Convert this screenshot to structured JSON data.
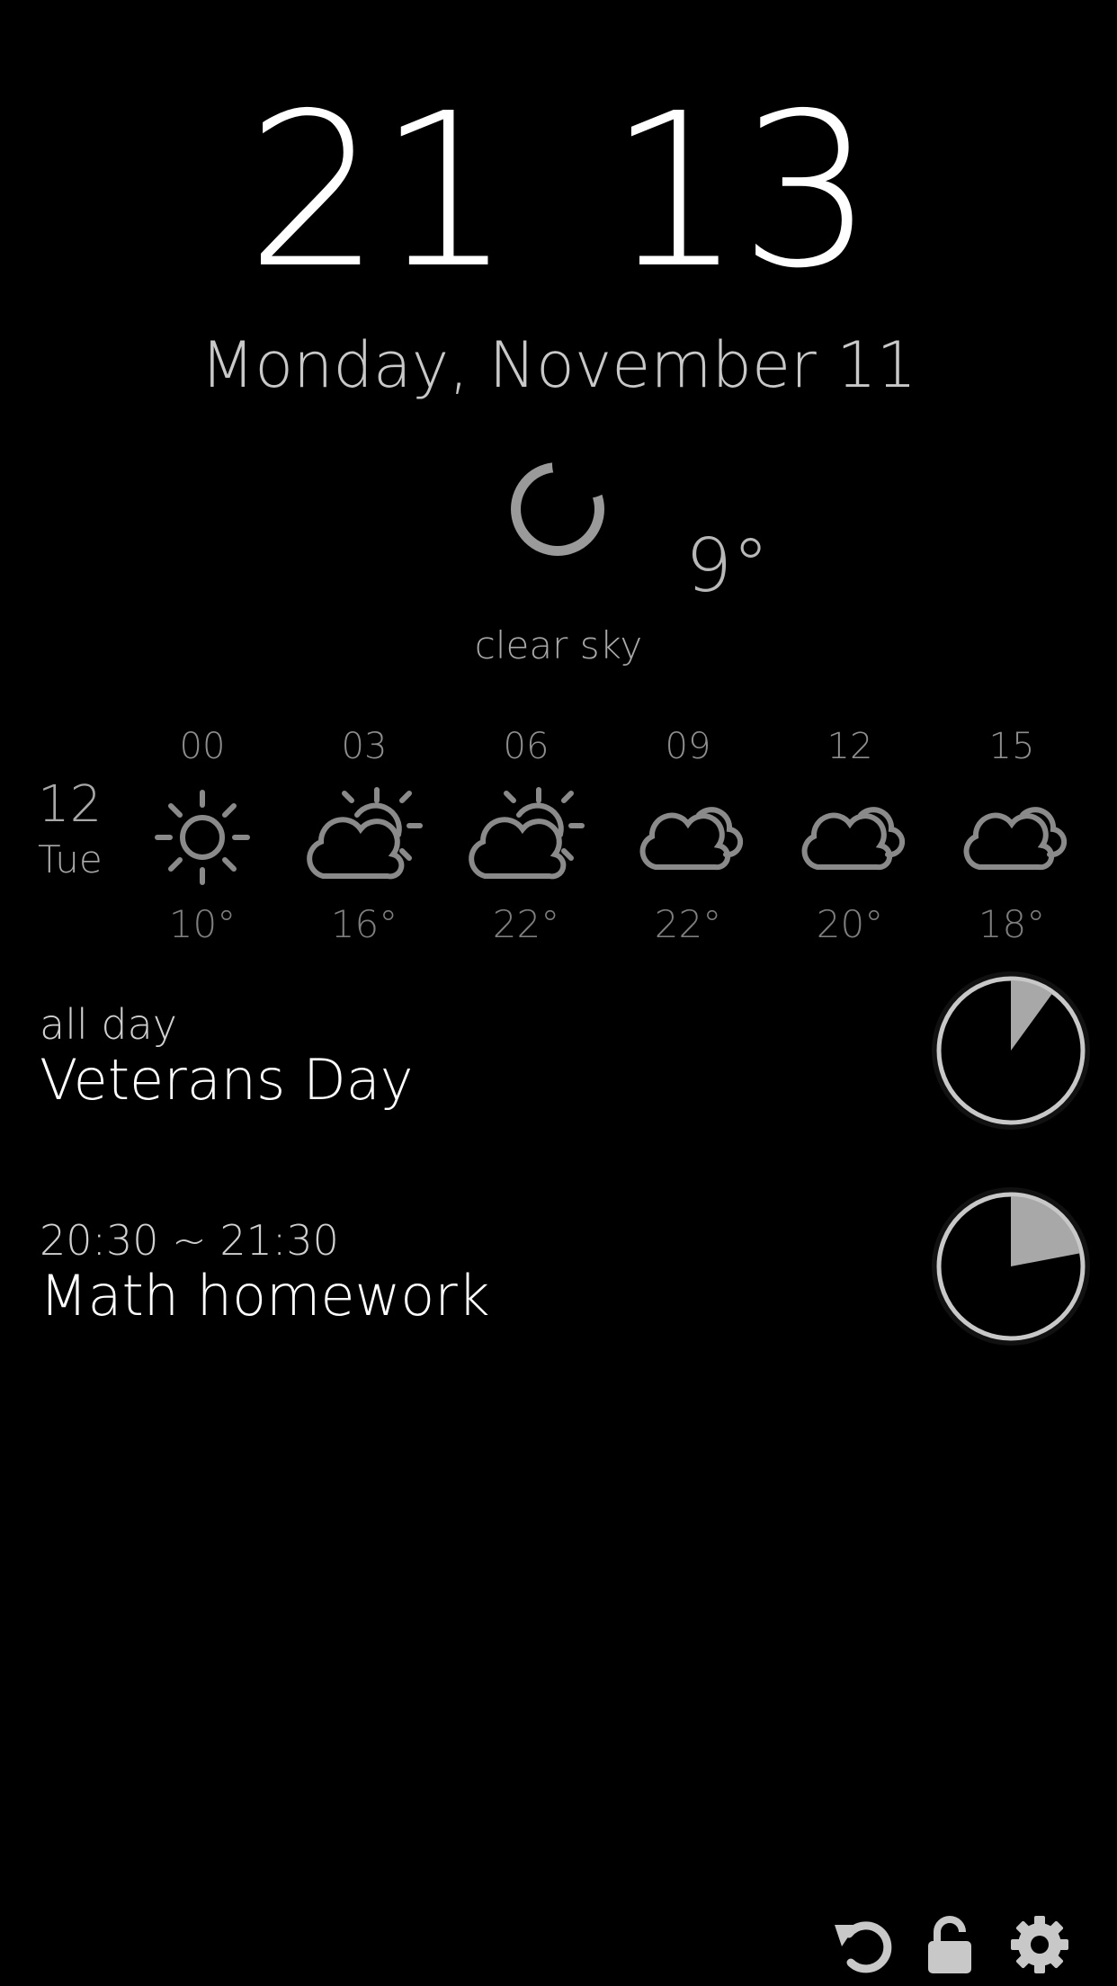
{
  "clock": {
    "hour": "21",
    "minute": "13"
  },
  "date": "Monday, November 11",
  "current": {
    "icon": "moon-icon",
    "temp": "9°",
    "condition": "clear sky"
  },
  "forecast": {
    "day_num": "12",
    "day_name": "Tue",
    "slots": [
      {
        "hour": "00",
        "icon": "sun-icon",
        "temp": "10°"
      },
      {
        "hour": "03",
        "icon": "partly-cloudy-icon",
        "temp": "16°"
      },
      {
        "hour": "06",
        "icon": "partly-cloudy-icon",
        "temp": "22°"
      },
      {
        "hour": "09",
        "icon": "cloud-icon",
        "temp": "22°"
      },
      {
        "hour": "12",
        "icon": "cloud-icon",
        "temp": "20°"
      },
      {
        "hour": "15",
        "icon": "cloud-icon",
        "temp": "18°"
      }
    ]
  },
  "events": [
    {
      "time": "all day",
      "title": "Veterans Day",
      "progress": 0.1
    },
    {
      "time": "20:30 ~ 21:30",
      "title": "Math homework",
      "progress": 0.22
    }
  ],
  "toolbar": {
    "refresh_icon": "refresh-icon",
    "lock_icon": "lock-icon",
    "settings_icon": "gear-icon"
  },
  "colors": {
    "background": "#000000",
    "foreground": "#ffffff",
    "icon_gray": "#8a8a8a",
    "pie_fill": "#a8a8a8",
    "pie_ring": "#c8c8c8"
  }
}
